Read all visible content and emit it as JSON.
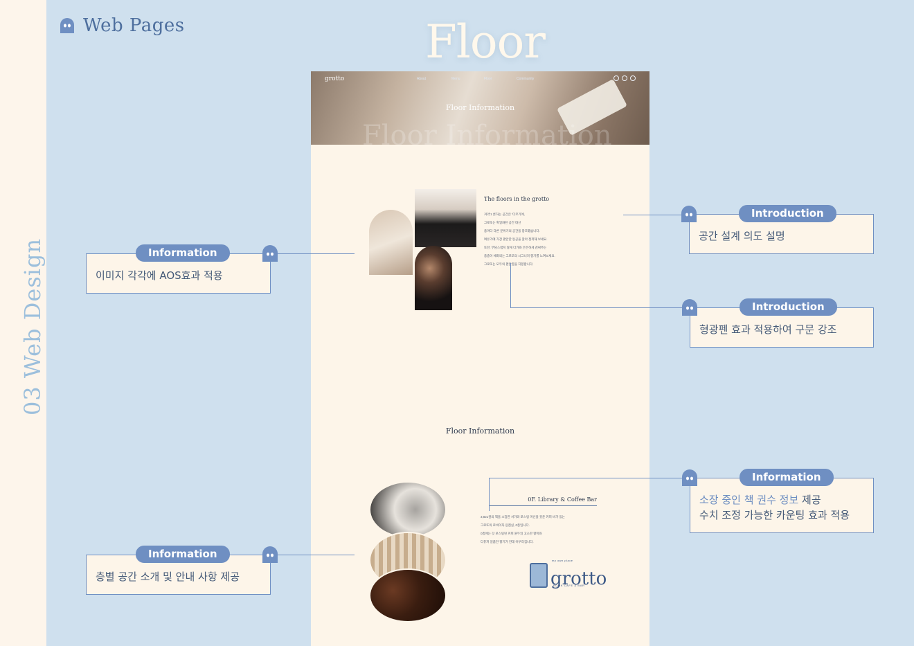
{
  "header": {
    "brand_text": "Web Pages",
    "page_title": "Floor",
    "section_label": "03 Web Design"
  },
  "mockup": {
    "logo": "grotto",
    "nav": [
      "About",
      "Menu",
      "Floor",
      "Community"
    ],
    "hero_subtitle": "Floor Information",
    "hero_watermark": "Floor Information",
    "intro_title": "The floors in the grotto",
    "intro_lines": [
      "겨약'1 론하는 공간은 '다르기에,",
      "그로또는 획일화된 공간 대신",
      "층마다 다른 분위기의 공간을 창조했습니다.",
      "여유가에 가장 편안한 등공을 찾아 정착해 보세요.",
      "또한, 부담스럽지 않게 다가와 은은하게 감싸주는",
      "층층이 체화되는 그로또의 시그니처 향기를 느껴보세요.",
      "그로또는 모두의 편안함을 지향합니다."
    ],
    "floor_section_title": "Floor Information",
    "floor_name": "0F. Library & Coffee Bar",
    "floor_lines": [
      "3,821권의 책을 소장한 서가와 로스팅 머신을 갖춘 커피 바가 있는",
      "그로또의 로비이자 응접실, 0층입니다.",
      "0층에는 갓 로스팅된 커피 원두의 고소한 향미와",
      "디퓨저 일품한 향기가 한데 어우러집니다."
    ],
    "brand_logo": {
      "tagline": "my own place",
      "word": "grotto",
      "sub": "BOOK CAFE & BAR"
    }
  },
  "callouts": {
    "left_top": {
      "tag": "Information",
      "text": "이미지 각각에 AOS효과 적용"
    },
    "left_bottom": {
      "tag": "Information",
      "text": "층별 공간 소개 및 안내 사항 제공"
    },
    "right_1": {
      "tag": "Introduction",
      "text": "공간 설계 의도 설명"
    },
    "right_2": {
      "tag": "Introduction",
      "text": "형광펜 효과 적용하여 구문 강조"
    },
    "right_3": {
      "tag": "Information",
      "line1_highlight": "소장 중인 책 권수 정보",
      "line1_rest": " 제공",
      "line2": "수치 조정 가능한 카운팅 효과 적용"
    }
  },
  "colors": {
    "background": "#cfe0ee",
    "strip": "#fdf5eb",
    "accent": "#6f8fc2",
    "page": "#fdf5e9"
  }
}
